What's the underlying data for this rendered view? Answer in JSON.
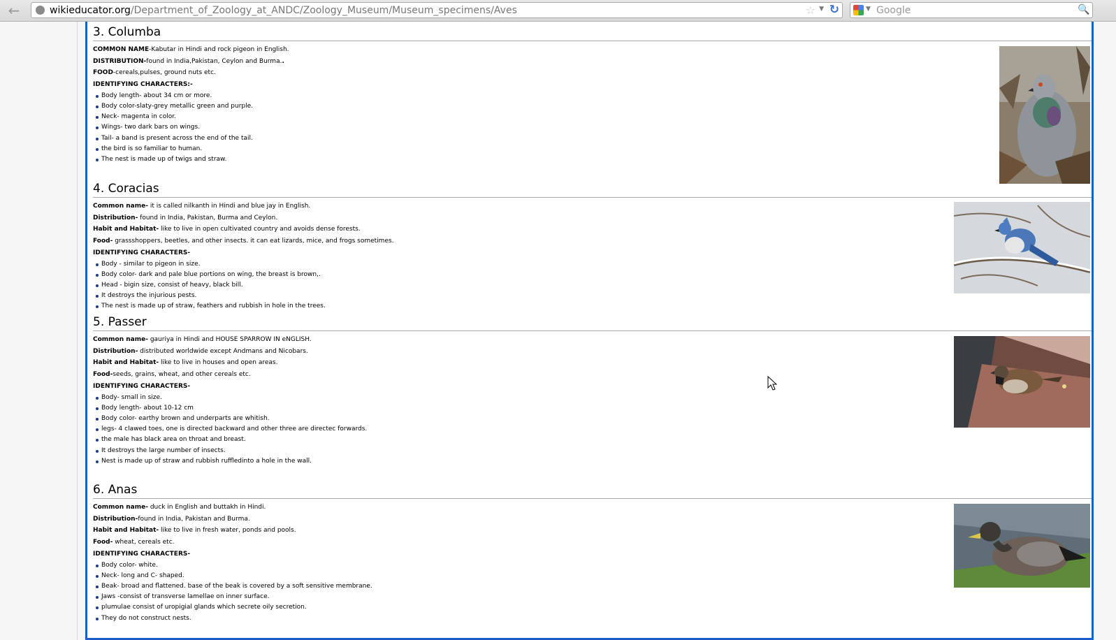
{
  "browser": {
    "back_icon": "back-arrow-icon",
    "url_domain": "wikieducator.org",
    "url_path": "/Department_of_Zoology_at_ANDC/Zoology_Museum/Museum_specimens/Aves",
    "search_placeholder": "Google",
    "reload_icon": "reload-icon",
    "star_icon": "star-icon",
    "search_icon": "magnifier-icon"
  },
  "sections": [
    {
      "heading": "3. Columba",
      "fields": [
        {
          "label": "COMMON NAME",
          "text": "-Kabutar in Hindi and rock pigeon in English."
        },
        {
          "label": "DISTRIBUTION-",
          "text": "found in India,Pakistan, Ceylon and Burma."
        },
        {
          "label": "FOOD",
          "text": "-cereals,pulses, ground nuts etc."
        },
        {
          "label": "IDENTIFYING CHARACTERS:-",
          "text": ""
        }
      ],
      "bullets": [
        "Body length- about 34 cm or more.",
        "Body color-slaty-grey metallic green and purple.",
        "Neck- magenta in color.",
        "Wings- two dark bars on wings.",
        "Tail- a band is present across the end of the tail.",
        "the bird is so familiar to human.",
        "The nest is made up of twigs and straw."
      ]
    },
    {
      "heading": "4. Coracias",
      "fields": [
        {
          "label": "Common name-",
          "text": " it is called nilkanth in Hindi and blue jay in English."
        },
        {
          "label": "Distribution-",
          "text": " found in India, Pakistan, Burma and Ceylon."
        },
        {
          "label": "Habit and Habitat-",
          "text": " like to live in open cultivated country and avoids dense forests."
        },
        {
          "label": "Food-",
          "text": " grassshoppers, beetles, and other insects. it can eat lizards, mice, and frogs sometimes."
        },
        {
          "label": "IDENTIFYING CHARACTERS-",
          "text": ""
        }
      ],
      "bullets": [
        "Body - similar to pigeon in size.",
        "Body color-  dark and pale blue portions on wing, the breast is brown,.",
        "Head - bigin size, consist of  heavy, black bill.",
        "It destroys the injurious pests.",
        "The nest is made up of straw, feathers and rubbish in  hole in the trees."
      ]
    },
    {
      "heading": "5. Passer",
      "fields": [
        {
          "label": "Common name-",
          "text": " gauriya in Hindi and HOUSE SPARROW IN eNGLISH."
        },
        {
          "label": "Distribution-",
          "text": " distributed worldwide except Andmans and Nicobars."
        },
        {
          "label": "Habit and Habitat-",
          "text": " like to live in houses and open areas."
        },
        {
          "label": "Food-",
          "text": "seeds, grains, wheat, and other cereals etc."
        },
        {
          "label": "IDENTIFYING CHARACTERS-",
          "text": ""
        }
      ],
      "bullets": [
        "Body- small in size.",
        "Body length- about 10-12 cm",
        "Body color- earthy brown and underparts are whitish.",
        "legs- 4 clawed toes, one is directed backward and other three are directec forwards.",
        "the male has black area on throat and breast.",
        "It destroys the large number of insects.",
        "Nest is made up of straw and rubbish ruffledinto a hole in the wall."
      ]
    },
    {
      "heading": "6. Anas",
      "fields": [
        {
          "label": "Common name-",
          "text": " duck in English and buttakh in Hindi."
        },
        {
          "label": "Distribution-",
          "text": "found in India, Pakistan and Burma."
        },
        {
          "label": "Habit and Habitat-",
          "text": " like to live in fresh water, ponds and pools."
        },
        {
          "label": "Food-",
          "text": " wheat, cereals etc."
        },
        {
          "label": "IDENTIFYING CHARACTERS-",
          "text": ""
        }
      ],
      "bullets": [
        "Body color- white.",
        "Neck- long and C- shaped.",
        "Beak- broad and flattened. base of the beak is covered by a soft sensitive membrane.",
        "Jaws -consist of transverse lamellae on inner surface.",
        "plumulae consist of uropigial glands which secrete oily secretion.",
        "They do not construct nests."
      ]
    }
  ],
  "photos": [
    {
      "subject": "pigeon-photo"
    },
    {
      "subject": "blue-jay-photo"
    },
    {
      "subject": "sparrow-photo"
    },
    {
      "subject": "duck-photo"
    }
  ],
  "cursor_icon": "mouse-pointer-icon"
}
